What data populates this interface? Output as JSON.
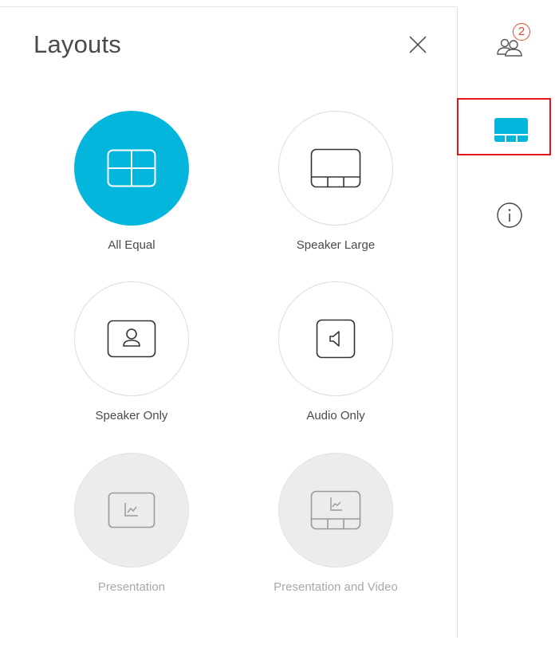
{
  "panel": {
    "title": "Layouts",
    "close_label": "×"
  },
  "layouts": [
    {
      "label": "All Equal",
      "icon": "grid-2x2-icon",
      "state": "selected"
    },
    {
      "label": "Speaker Large",
      "icon": "speaker-large-icon",
      "state": "normal"
    },
    {
      "label": "Speaker Only",
      "icon": "speaker-only-icon",
      "state": "normal"
    },
    {
      "label": "Audio Only",
      "icon": "audio-only-icon",
      "state": "normal"
    },
    {
      "label": "Presentation",
      "icon": "presentation-icon",
      "state": "disabled"
    },
    {
      "label": "Presentation and Video",
      "icon": "presentation-video-icon",
      "state": "disabled"
    }
  ],
  "rail": {
    "participants_badge": "2",
    "items": [
      "participants-icon",
      "layout-icon",
      "info-icon"
    ]
  },
  "colors": {
    "accent": "#05b6dc",
    "highlight": "#e4151b",
    "badge": "#e0463a",
    "text": "#4a4a4a",
    "disabled_text": "#a8a8a8"
  }
}
